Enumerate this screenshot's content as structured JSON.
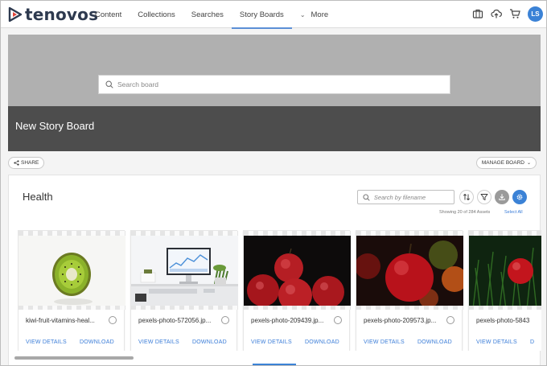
{
  "app": {
    "logo_text": "tenovos",
    "brand_color": "#3b82d6"
  },
  "nav": {
    "items": [
      {
        "label": "Content",
        "active": false
      },
      {
        "label": "Collections",
        "active": false
      },
      {
        "label": "Searches",
        "active": false
      },
      {
        "label": "Story Boards",
        "active": true
      },
      {
        "label": "More",
        "active": false
      }
    ],
    "icons": [
      "briefcase-icon",
      "upload-cloud-icon",
      "cart-icon"
    ],
    "avatar_initials": "LS"
  },
  "hero": {
    "search_placeholder": "Search board",
    "title": "New Story Board"
  },
  "actions": {
    "share_label": "SHARE",
    "manage_label": "MANAGE BOARD"
  },
  "board": {
    "title": "Health",
    "file_search_placeholder": "Search by filename",
    "showing_text": "Showing 20 of 284 Assets",
    "select_all": "Select All"
  },
  "cards": [
    {
      "name": "kiwi-fruit-vitamins-heal...",
      "image": "kiwi",
      "view_label": "VIEW DETAILS",
      "download_label": "DOWNLOAD"
    },
    {
      "name": "pexels-photo-572056.jp...",
      "image": "desk",
      "view_label": "VIEW DETAILS",
      "download_label": "DOWNLOAD"
    },
    {
      "name": "pexels-photo-209439.jp...",
      "image": "apples",
      "view_label": "VIEW DETAILS",
      "download_label": "DOWNLOAD"
    },
    {
      "name": "pexels-photo-209573.jp...",
      "image": "apple-single",
      "view_label": "VIEW DETAILS",
      "download_label": "DOWNLOAD"
    },
    {
      "name": "pexels-photo-5843",
      "image": "apple-grass",
      "view_label": "VIEW DETAILS",
      "download_label": "D"
    }
  ]
}
